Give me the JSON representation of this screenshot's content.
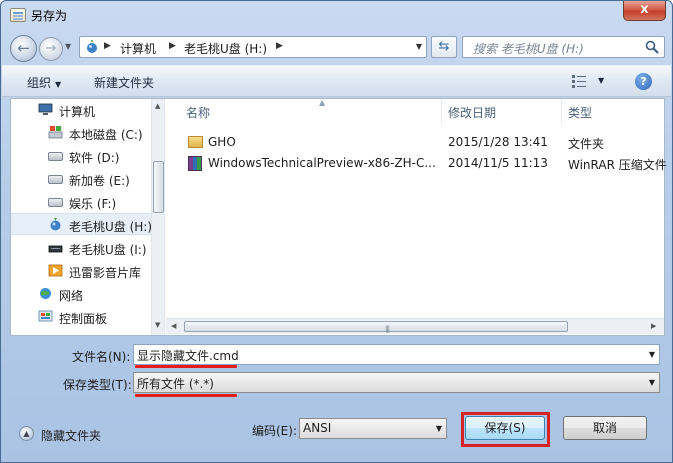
{
  "window": {
    "title": "另存为",
    "close_label": "x"
  },
  "address": {
    "breadcrumb": [
      "计算机",
      "老毛桃U盘 (H:)"
    ]
  },
  "search": {
    "placeholder": "搜索 老毛桃U盘 (H:)"
  },
  "toolbar": {
    "organize": "组织",
    "new_folder": "新建文件夹"
  },
  "sidebar": {
    "items": [
      {
        "label": "计算机",
        "icon": "computer-icon"
      },
      {
        "label": "本地磁盘 (C:)",
        "icon": "system-drive-icon"
      },
      {
        "label": "软件 (D:)",
        "icon": "drive-icon"
      },
      {
        "label": "新加卷 (E:)",
        "icon": "drive-icon"
      },
      {
        "label": "娱乐 (F:)",
        "icon": "drive-icon"
      },
      {
        "label": "老毛桃U盘 (H:)",
        "icon": "usb-drive-icon",
        "selected": true
      },
      {
        "label": "老毛桃U盘 (I:)",
        "icon": "usb-drive-icon"
      },
      {
        "label": "迅雷影音片库",
        "icon": "media-library-icon"
      },
      {
        "label": "网络",
        "icon": "network-icon"
      },
      {
        "label": "控制面板",
        "icon": "control-panel-icon"
      }
    ]
  },
  "file_list": {
    "columns": [
      "名称",
      "修改日期",
      "类型"
    ],
    "rows": [
      {
        "name": "GHO",
        "date": "2015/1/28 13:41",
        "type": "文件夹",
        "icon": "folder-icon"
      },
      {
        "name": "WindowsTechnicalPreview-x86-ZH-C...",
        "date": "2014/11/5 11:13",
        "type": "WinRAR 压缩文件",
        "icon": "winrar-archive-icon"
      }
    ]
  },
  "form": {
    "filename_label": "文件名(N):",
    "filename_value": "显示隐藏文件.cmd",
    "filetype_label": "保存类型(T):",
    "filetype_value": "所有文件  (*.*)",
    "encoding_label": "编码(E):",
    "encoding_value": "ANSI"
  },
  "footer": {
    "hide_folders": "隐藏文件夹",
    "save": "保存(S)",
    "cancel": "取消"
  },
  "colors": {
    "highlight_red": "#e31d1d",
    "selected_bg": "#e6eef8"
  }
}
